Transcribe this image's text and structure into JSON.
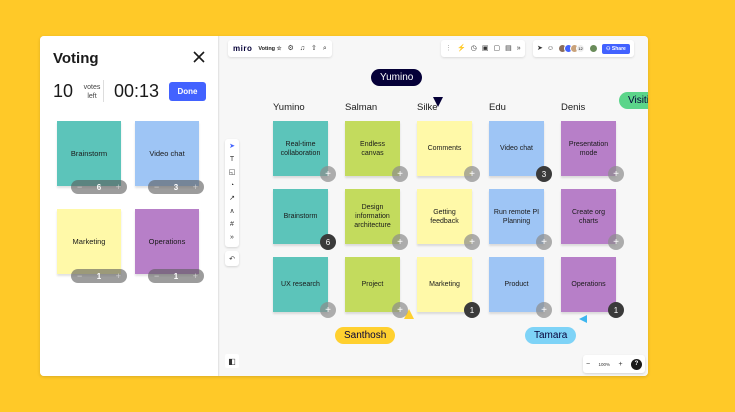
{
  "panel": {
    "title": "Voting",
    "votes_count": "10",
    "votes_label_1": "votes",
    "votes_label_2": "left",
    "timer": "00:13",
    "done_label": "Done",
    "notes": [
      {
        "label": "Brainstorm",
        "votes": "6",
        "color": "#5CC4BA"
      },
      {
        "label": "Video chat",
        "votes": "3",
        "color": "#9EC5F5"
      },
      {
        "label": "Marketing",
        "votes": "1",
        "color": "#FFF9A8"
      },
      {
        "label": "Operations",
        "votes": "1",
        "color": "#B77FC8"
      }
    ]
  },
  "canvas": {
    "logo": "miro",
    "board_name": "Voting",
    "share_label": "Share",
    "avatar_count": "12",
    "zoom": "100%",
    "columns": [
      "Yumino",
      "Salman",
      "Silke",
      "Edu",
      "Denis"
    ],
    "rows": [
      [
        {
          "label": "Real-time collaboration",
          "color": "#5CC4BA",
          "count": ""
        },
        {
          "label": "Endless canvas",
          "color": "#C3DB5D",
          "count": ""
        },
        {
          "label": "Comments",
          "color": "#FFF9A8",
          "count": ""
        },
        {
          "label": "Video chat",
          "color": "#9EC5F5",
          "count": "3"
        },
        {
          "label": "Presentation mode",
          "color": "#B77FC8",
          "count": ""
        }
      ],
      [
        {
          "label": "Brainstorm",
          "color": "#5CC4BA",
          "count": "6"
        },
        {
          "label": "Design information architecture",
          "color": "#C3DB5D",
          "count": ""
        },
        {
          "label": "Getting feedback",
          "color": "#FFF9A8",
          "count": ""
        },
        {
          "label": "Run remote PI Planning",
          "color": "#9EC5F5",
          "count": ""
        },
        {
          "label": "Create org charts",
          "color": "#B77FC8",
          "count": ""
        }
      ],
      [
        {
          "label": "UX research",
          "color": "#5CC4BA",
          "count": ""
        },
        {
          "label": "Project",
          "color": "#C3DB5D",
          "count": ""
        },
        {
          "label": "Marketing",
          "color": "#FFF9A8",
          "count": "1"
        },
        {
          "label": "Product",
          "color": "#9EC5F5",
          "count": ""
        },
        {
          "label": "Operations",
          "color": "#B77FC8",
          "count": "1"
        }
      ]
    ],
    "cursors": [
      {
        "name": "Yumino",
        "bg": "#050038",
        "fg": "#ffffff"
      },
      {
        "name": "Visiting Explorer",
        "bg": "#5BD58A",
        "fg": "#050038"
      },
      {
        "name": "Santhosh",
        "bg": "#FFD02F",
        "fg": "#050038"
      },
      {
        "name": "Tamara",
        "bg": "#7ED3F7",
        "fg": "#050038"
      }
    ]
  }
}
